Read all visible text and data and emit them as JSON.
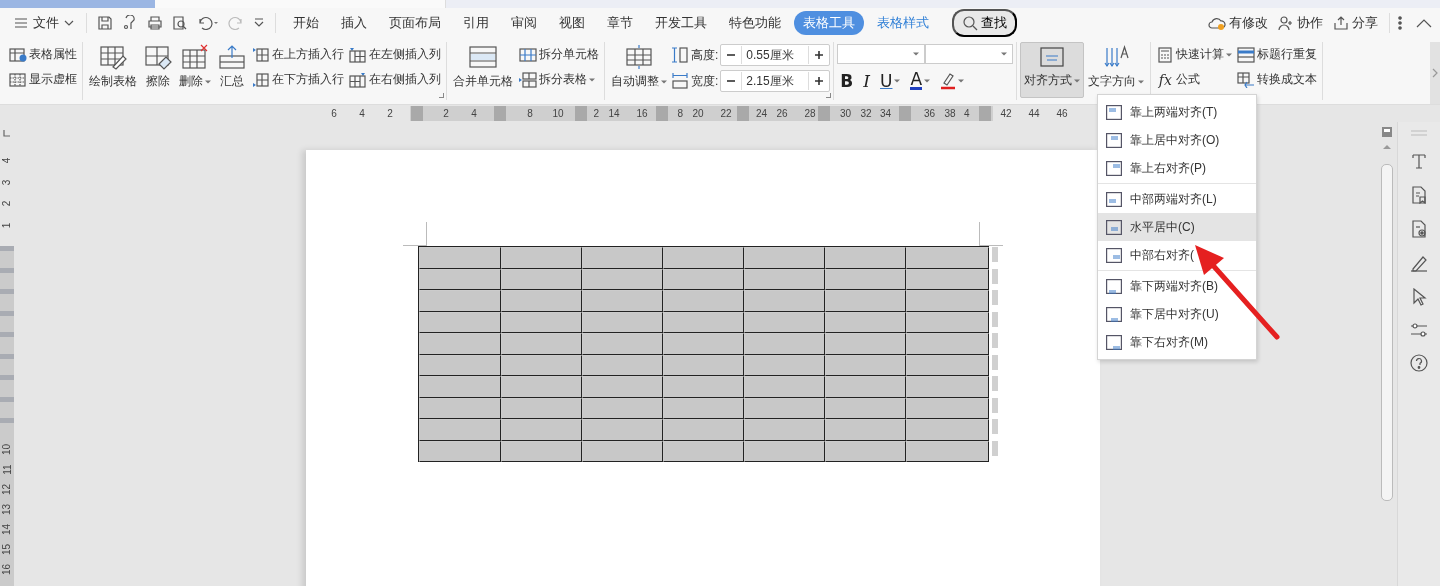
{
  "menu_bar": {
    "file_label": "文件",
    "tabs": [
      {
        "label": "开始",
        "selected": false,
        "contextual": false
      },
      {
        "label": "插入",
        "selected": false,
        "contextual": false
      },
      {
        "label": "页面布局",
        "selected": false,
        "contextual": false
      },
      {
        "label": "引用",
        "selected": false,
        "contextual": false
      },
      {
        "label": "审阅",
        "selected": false,
        "contextual": false
      },
      {
        "label": "视图",
        "selected": false,
        "contextual": false
      },
      {
        "label": "章节",
        "selected": false,
        "contextual": false
      },
      {
        "label": "开发工具",
        "selected": false,
        "contextual": false
      },
      {
        "label": "特色功能",
        "selected": false,
        "contextual": false
      },
      {
        "label": "表格工具",
        "selected": true,
        "contextual": true
      },
      {
        "label": "表格样式",
        "selected": false,
        "contextual": true
      }
    ],
    "search": "查找",
    "actions": [
      "有修改",
      "协作",
      "分享"
    ]
  },
  "ribbon": {
    "sections": [
      {
        "launcher": false,
        "items": [
          {
            "kind": "stack",
            "buttons": [
              {
                "label": "表格属性",
                "dropdown": false
              },
              {
                "label": "显示虚框",
                "dropdown": false
              }
            ]
          }
        ]
      },
      {
        "launcher": true,
        "items": [
          {
            "kind": "large",
            "label": "绘制表格",
            "dropdown": false,
            "pressed": false
          },
          {
            "kind": "large",
            "label": "擦除",
            "dropdown": false,
            "pressed": false
          },
          {
            "kind": "large",
            "label": "删除",
            "dropdown": true,
            "pressed": false
          },
          {
            "kind": "large",
            "label": "汇总",
            "dropdown": false,
            "pressed": false
          },
          {
            "kind": "stack",
            "buttons": [
              {
                "label": "在上方插入行",
                "dropdown": false
              },
              {
                "label": "在下方插入行",
                "dropdown": false
              }
            ]
          },
          {
            "kind": "stack",
            "buttons": [
              {
                "label": "在左侧插入列",
                "dropdown": false
              },
              {
                "label": "在右侧插入列",
                "dropdown": false
              }
            ]
          }
        ]
      },
      {
        "launcher": false,
        "items": [
          {
            "kind": "large",
            "label": "合并单元格",
            "dropdown": false,
            "pressed": false
          },
          {
            "kind": "stack",
            "buttons": [
              {
                "label": "拆分单元格",
                "dropdown": false
              },
              {
                "label": "拆分表格",
                "dropdown": true
              }
            ]
          }
        ]
      },
      {
        "launcher": true,
        "items": [
          {
            "kind": "large",
            "label": "自动调整",
            "dropdown": true,
            "pressed": false
          },
          {
            "kind": "size",
            "fields": [
              {
                "label": "高度:",
                "value": "0.55厘米"
              },
              {
                "label": "宽度:",
                "value": "2.15厘米"
              }
            ]
          }
        ]
      },
      {
        "launcher": false,
        "items": [
          {
            "kind": "font",
            "format_buttons": [
              {
                "kind": "bold",
                "label": "B",
                "dropdown": false
              },
              {
                "kind": "italic",
                "label": "I",
                "dropdown": false
              },
              {
                "kind": "underline",
                "label": "U",
                "dropdown": true
              },
              {
                "kind": "color",
                "label": "A",
                "dropdown": true
              },
              {
                "kind": "highlight",
                "dropdown": true
              }
            ]
          }
        ]
      },
      {
        "launcher": false,
        "items": [
          {
            "kind": "large",
            "label": "对齐方式",
            "dropdown": true,
            "pressed": true
          },
          {
            "kind": "large",
            "label": "文字方向",
            "dropdown": true,
            "pressed": false
          }
        ]
      },
      {
        "launcher": false,
        "items": [
          {
            "kind": "stack",
            "buttons": [
              {
                "label": "快速计算",
                "dropdown": true
              },
              {
                "label": "公式",
                "glyph": "fx",
                "dropdown": false
              }
            ]
          },
          {
            "kind": "stack",
            "buttons": [
              {
                "label": "标题行重复",
                "dropdown": false
              },
              {
                "label": "转换成文本",
                "dropdown": false
              }
            ]
          }
        ]
      }
    ]
  },
  "ruler": {
    "marks": [
      {
        "kind": "num",
        "label": "6"
      },
      {
        "kind": "num",
        "label": "4"
      },
      {
        "kind": "num",
        "label": "2"
      },
      {
        "kind": "gap"
      },
      {
        "kind": "num",
        "label": "2"
      },
      {
        "kind": "num",
        "label": "4"
      },
      {
        "kind": "gap"
      },
      {
        "kind": "num",
        "label": "8"
      },
      {
        "kind": "num",
        "label": "10"
      },
      {
        "kind": "after-marker",
        "label": "2"
      },
      {
        "kind": "num",
        "label": "14"
      },
      {
        "kind": "num",
        "label": "16"
      },
      {
        "kind": "after-marker",
        "label": "8"
      },
      {
        "kind": "num",
        "label": "20"
      },
      {
        "kind": "num",
        "label": "22"
      },
      {
        "kind": "after-marker",
        "label": "24"
      },
      {
        "kind": "num",
        "label": "26"
      },
      {
        "kind": "num",
        "label": "28"
      },
      {
        "kind": "after-marker",
        "label": "30"
      },
      {
        "kind": "num",
        "label": "32"
      },
      {
        "kind": "before-marker",
        "label": "34"
      },
      {
        "kind": "after-marker",
        "label": "36"
      },
      {
        "kind": "num",
        "label": "38"
      },
      {
        "kind": "before-marker",
        "label": "4"
      },
      {
        "kind": "num",
        "label": "42"
      },
      {
        "kind": "num",
        "label": "44"
      },
      {
        "kind": "num",
        "label": "46"
      }
    ]
  },
  "vertical_ruler": {
    "top_labels": [
      "4",
      "3",
      "2",
      "1"
    ],
    "bottom_labels": [
      "10",
      "11",
      "12",
      "13",
      "14",
      "15",
      "16"
    ]
  },
  "table": {
    "rows": [
      {
        "cells": [
          {
            "selected": true
          },
          {
            "selected": true
          },
          {
            "selected": true
          },
          {
            "selected": true
          },
          {
            "selected": true
          },
          {
            "selected": true
          },
          {
            "selected": true
          }
        ]
      },
      {
        "cells": [
          {
            "selected": true
          },
          {
            "selected": true
          },
          {
            "selected": true
          },
          {
            "selected": true
          },
          {
            "selected": true
          },
          {
            "selected": true
          },
          {
            "selected": true
          }
        ]
      },
      {
        "cells": [
          {
            "selected": true
          },
          {
            "selected": true
          },
          {
            "selected": true
          },
          {
            "selected": true
          },
          {
            "selected": true
          },
          {
            "selected": true
          },
          {
            "selected": true
          }
        ]
      },
      {
        "cells": [
          {
            "selected": true
          },
          {
            "selected": true
          },
          {
            "selected": true
          },
          {
            "selected": true
          },
          {
            "selected": true
          },
          {
            "selected": true
          },
          {
            "selected": true
          }
        ]
      },
      {
        "cells": [
          {
            "selected": true
          },
          {
            "selected": true
          },
          {
            "selected": true
          },
          {
            "selected": true
          },
          {
            "selected": true
          },
          {
            "selected": true
          },
          {
            "selected": true
          }
        ]
      },
      {
        "cells": [
          {
            "selected": true
          },
          {
            "selected": true
          },
          {
            "selected": true
          },
          {
            "selected": true
          },
          {
            "selected": true
          },
          {
            "selected": true
          },
          {
            "selected": true
          }
        ]
      },
      {
        "cells": [
          {
            "selected": true
          },
          {
            "selected": true
          },
          {
            "selected": true
          },
          {
            "selected": true
          },
          {
            "selected": true
          },
          {
            "selected": true
          },
          {
            "selected": true
          }
        ]
      },
      {
        "cells": [
          {
            "selected": true
          },
          {
            "selected": true
          },
          {
            "selected": true
          },
          {
            "selected": true
          },
          {
            "selected": true
          },
          {
            "selected": true
          },
          {
            "selected": true
          }
        ]
      },
      {
        "cells": [
          {
            "selected": true
          },
          {
            "selected": true
          },
          {
            "selected": true
          },
          {
            "selected": true
          },
          {
            "selected": true
          },
          {
            "selected": true
          },
          {
            "selected": true
          }
        ]
      },
      {
        "cells": [
          {
            "selected": true
          },
          {
            "selected": true
          },
          {
            "selected": true
          },
          {
            "selected": true
          },
          {
            "selected": true
          },
          {
            "selected": true
          },
          {
            "selected": true
          }
        ]
      }
    ]
  },
  "dropdown_menu": {
    "sections": [
      {
        "items": [
          {
            "label": "靠上两端对齐(T)",
            "selected": false
          },
          {
            "label": "靠上居中对齐(O)",
            "selected": false
          },
          {
            "label": "靠上右对齐(P)",
            "selected": false
          }
        ]
      },
      {
        "items": [
          {
            "label": "中部两端对齐(L)",
            "selected": false
          },
          {
            "label": "水平居中(C)",
            "selected": true
          },
          {
            "label": "中部右对齐(",
            "selected": false
          }
        ]
      },
      {
        "items": [
          {
            "label": "靠下两端对齐(B)",
            "selected": false
          },
          {
            "label": "靠下居中对齐(U)",
            "selected": false
          },
          {
            "label": "靠下右对齐(M)",
            "selected": false
          }
        ]
      }
    ]
  }
}
